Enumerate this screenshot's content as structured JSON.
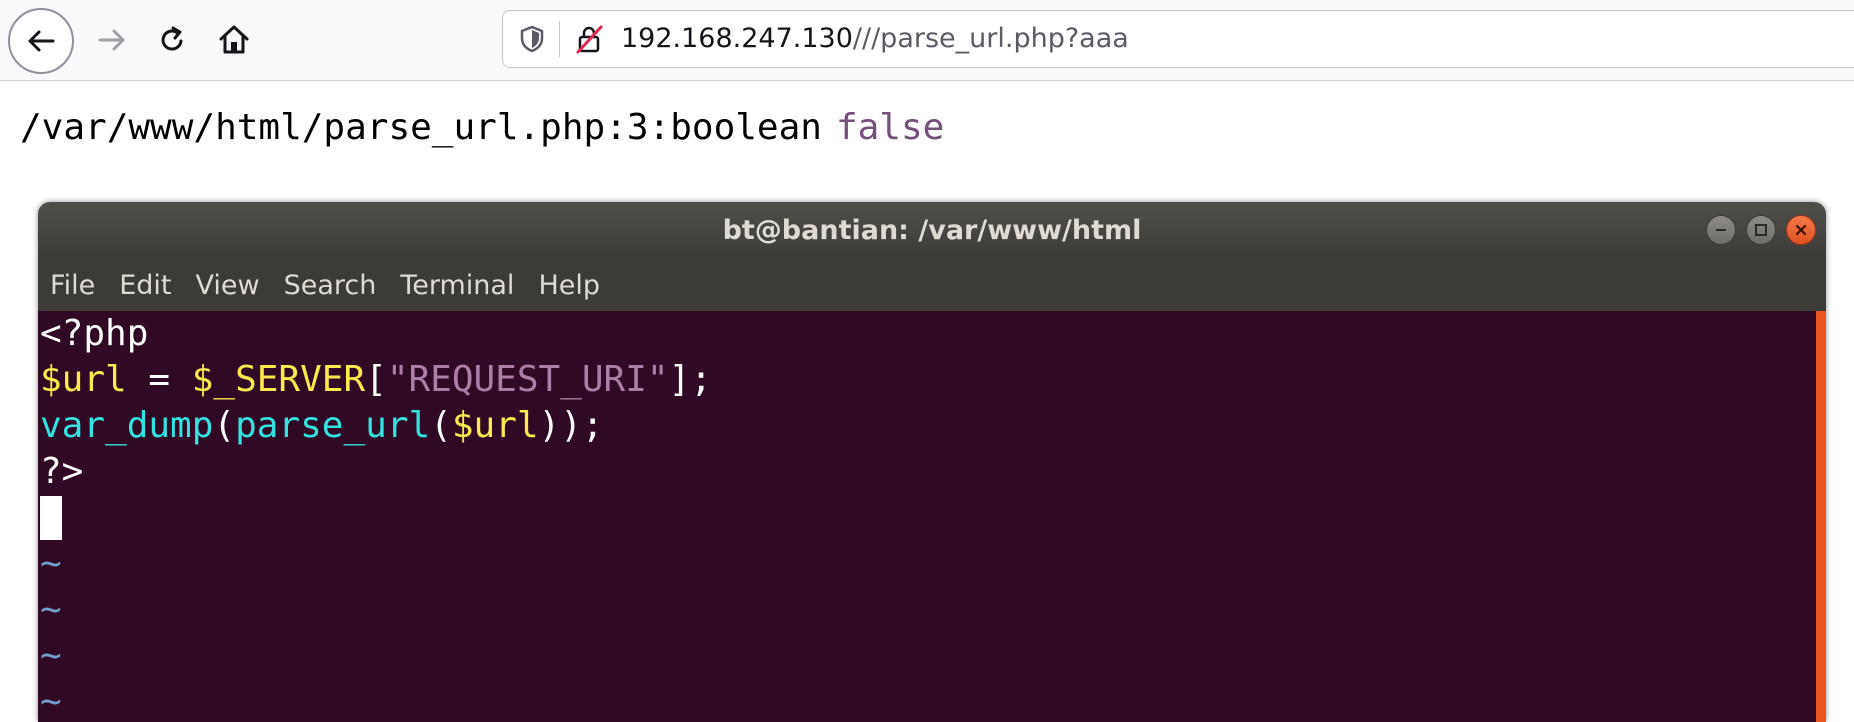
{
  "browser": {
    "url": {
      "host": "192.168.247.130",
      "path": "///parse_url.php?aaa"
    }
  },
  "page_output": {
    "text": "/var/www/html/parse_url.php:3:boolean",
    "value": "false"
  },
  "terminal": {
    "title": "bt@bantian: /var/www/html",
    "menu": [
      "File",
      "Edit",
      "View",
      "Search",
      "Terminal",
      "Help"
    ],
    "code": {
      "line1": "<?php",
      "line2_var": "$url",
      "line2_eq": " = ",
      "line2_server": "$_SERVER",
      "line2_open": "[",
      "line2_str": "\"REQUEST_URI\"",
      "line2_close": "];",
      "line3_fn1": "var_dump",
      "line3_p1": "(",
      "line3_fn2": "parse_url",
      "line3_p2": "(",
      "line3_var": "$url",
      "line3_p3": "));",
      "line4": "?>",
      "tilde": "~"
    }
  },
  "colors": {
    "terminal_bg": "#300a24",
    "php_keyword": "#fce94f",
    "identifier": "#34e2e2",
    "string": "#ad7fa8",
    "false_value": "#75507b",
    "close_button": "#e95420"
  }
}
